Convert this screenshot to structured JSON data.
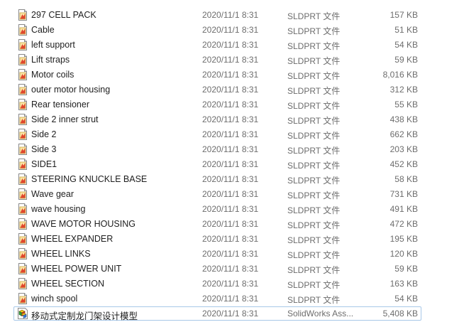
{
  "files": [
    {
      "name": "297 CELL PACK",
      "modified": "2020/11/1 8:31",
      "type": "SLDPRT 文件",
      "size": "157 KB",
      "icon": "sldprt-file-icon"
    },
    {
      "name": "Cable",
      "modified": "2020/11/1 8:31",
      "type": "SLDPRT 文件",
      "size": "51 KB",
      "icon": "sldprt-file-icon"
    },
    {
      "name": "left support",
      "modified": "2020/11/1 8:31",
      "type": "SLDPRT 文件",
      "size": "54 KB",
      "icon": "sldprt-file-icon"
    },
    {
      "name": "Lift straps",
      "modified": "2020/11/1 8:31",
      "type": "SLDPRT 文件",
      "size": "59 KB",
      "icon": "sldprt-file-icon"
    },
    {
      "name": "Motor coils",
      "modified": "2020/11/1 8:31",
      "type": "SLDPRT 文件",
      "size": "8,016 KB",
      "icon": "sldprt-file-icon"
    },
    {
      "name": "outer motor housing",
      "modified": "2020/11/1 8:31",
      "type": "SLDPRT 文件",
      "size": "312 KB",
      "icon": "sldprt-file-icon"
    },
    {
      "name": "Rear tensioner",
      "modified": "2020/11/1 8:31",
      "type": "SLDPRT 文件",
      "size": "55 KB",
      "icon": "sldprt-file-icon"
    },
    {
      "name": "Side 2 inner strut",
      "modified": "2020/11/1 8:31",
      "type": "SLDPRT 文件",
      "size": "438 KB",
      "icon": "sldprt-file-icon"
    },
    {
      "name": "Side 2",
      "modified": "2020/11/1 8:31",
      "type": "SLDPRT 文件",
      "size": "662 KB",
      "icon": "sldprt-file-icon"
    },
    {
      "name": "Side 3",
      "modified": "2020/11/1 8:31",
      "type": "SLDPRT 文件",
      "size": "203 KB",
      "icon": "sldprt-file-icon"
    },
    {
      "name": "SIDE1",
      "modified": "2020/11/1 8:31",
      "type": "SLDPRT 文件",
      "size": "452 KB",
      "icon": "sldprt-file-icon"
    },
    {
      "name": "STEERING KNUCKLE BASE",
      "modified": "2020/11/1 8:31",
      "type": "SLDPRT 文件",
      "size": "58 KB",
      "icon": "sldprt-file-icon"
    },
    {
      "name": "Wave gear",
      "modified": "2020/11/1 8:31",
      "type": "SLDPRT 文件",
      "size": "731 KB",
      "icon": "sldprt-file-icon"
    },
    {
      "name": "wave housing",
      "modified": "2020/11/1 8:31",
      "type": "SLDPRT 文件",
      "size": "491 KB",
      "icon": "sldprt-file-icon"
    },
    {
      "name": "WAVE MOTOR HOUSING",
      "modified": "2020/11/1 8:31",
      "type": "SLDPRT 文件",
      "size": "472 KB",
      "icon": "sldprt-file-icon"
    },
    {
      "name": "WHEEL EXPANDER",
      "modified": "2020/11/1 8:31",
      "type": "SLDPRT 文件",
      "size": "195 KB",
      "icon": "sldprt-file-icon"
    },
    {
      "name": "WHEEL LINKS",
      "modified": "2020/11/1 8:31",
      "type": "SLDPRT 文件",
      "size": "120 KB",
      "icon": "sldprt-file-icon"
    },
    {
      "name": "WHEEL POWER UNIT",
      "modified": "2020/11/1 8:31",
      "type": "SLDPRT 文件",
      "size": "59 KB",
      "icon": "sldprt-file-icon"
    },
    {
      "name": "WHEEL SECTION",
      "modified": "2020/11/1 8:31",
      "type": "SLDPRT 文件",
      "size": "163 KB",
      "icon": "sldprt-file-icon"
    },
    {
      "name": "winch spool",
      "modified": "2020/11/1 8:31",
      "type": "SLDPRT 文件",
      "size": "54 KB",
      "icon": "sldprt-file-icon"
    },
    {
      "name": "移动式定制龙门架设计模型",
      "modified": "2020/11/1 8:31",
      "type": "SolidWorks Ass...",
      "size": "5,408 KB",
      "icon": "sldasm-file-icon",
      "focused": true
    }
  ],
  "colors": {
    "text_primary": "#1e1e1e",
    "text_secondary": "#6d6d6d",
    "focus_border": "#a8c8e8"
  }
}
